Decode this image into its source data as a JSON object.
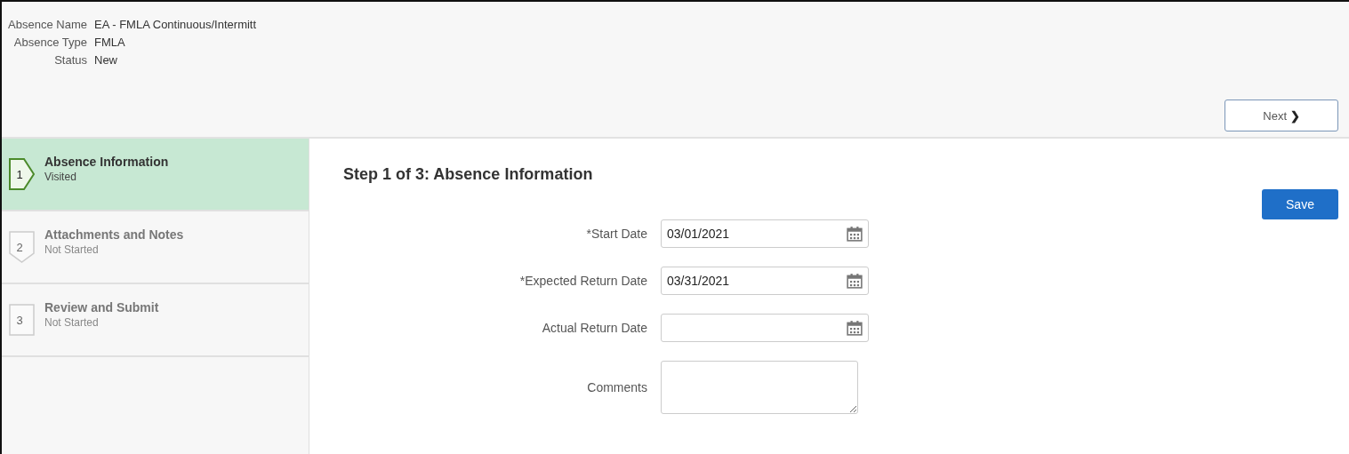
{
  "header": {
    "fields": [
      {
        "label": "Absence Name",
        "value": "EA - FMLA Continuous/Intermitt"
      },
      {
        "label": "Absence Type",
        "value": "FMLA"
      },
      {
        "label": "Status",
        "value": "New"
      }
    ],
    "next_button": {
      "label": "Next",
      "icon": "❯"
    }
  },
  "steps": [
    {
      "number": "1",
      "title": "Absence Information",
      "status": "Visited",
      "selected": true,
      "kind": "arrow"
    },
    {
      "number": "2",
      "title": "Attachments and Notes",
      "status": "Not Started",
      "selected": false,
      "kind": "pointer"
    },
    {
      "number": "3",
      "title": "Review and Submit",
      "status": "Not Started",
      "selected": false,
      "kind": "box"
    }
  ],
  "main": {
    "title": "Step 1 of 3: Absence Information",
    "save_button": "Save",
    "fields": [
      {
        "kind": "date",
        "label": "*Start Date",
        "value": "03/01/2021"
      },
      {
        "kind": "date",
        "label": "*Expected Return Date",
        "value": "03/31/2021"
      },
      {
        "kind": "date",
        "label": "Actual Return Date"
      },
      {
        "kind": "textarea",
        "label": "Comments"
      }
    ]
  }
}
